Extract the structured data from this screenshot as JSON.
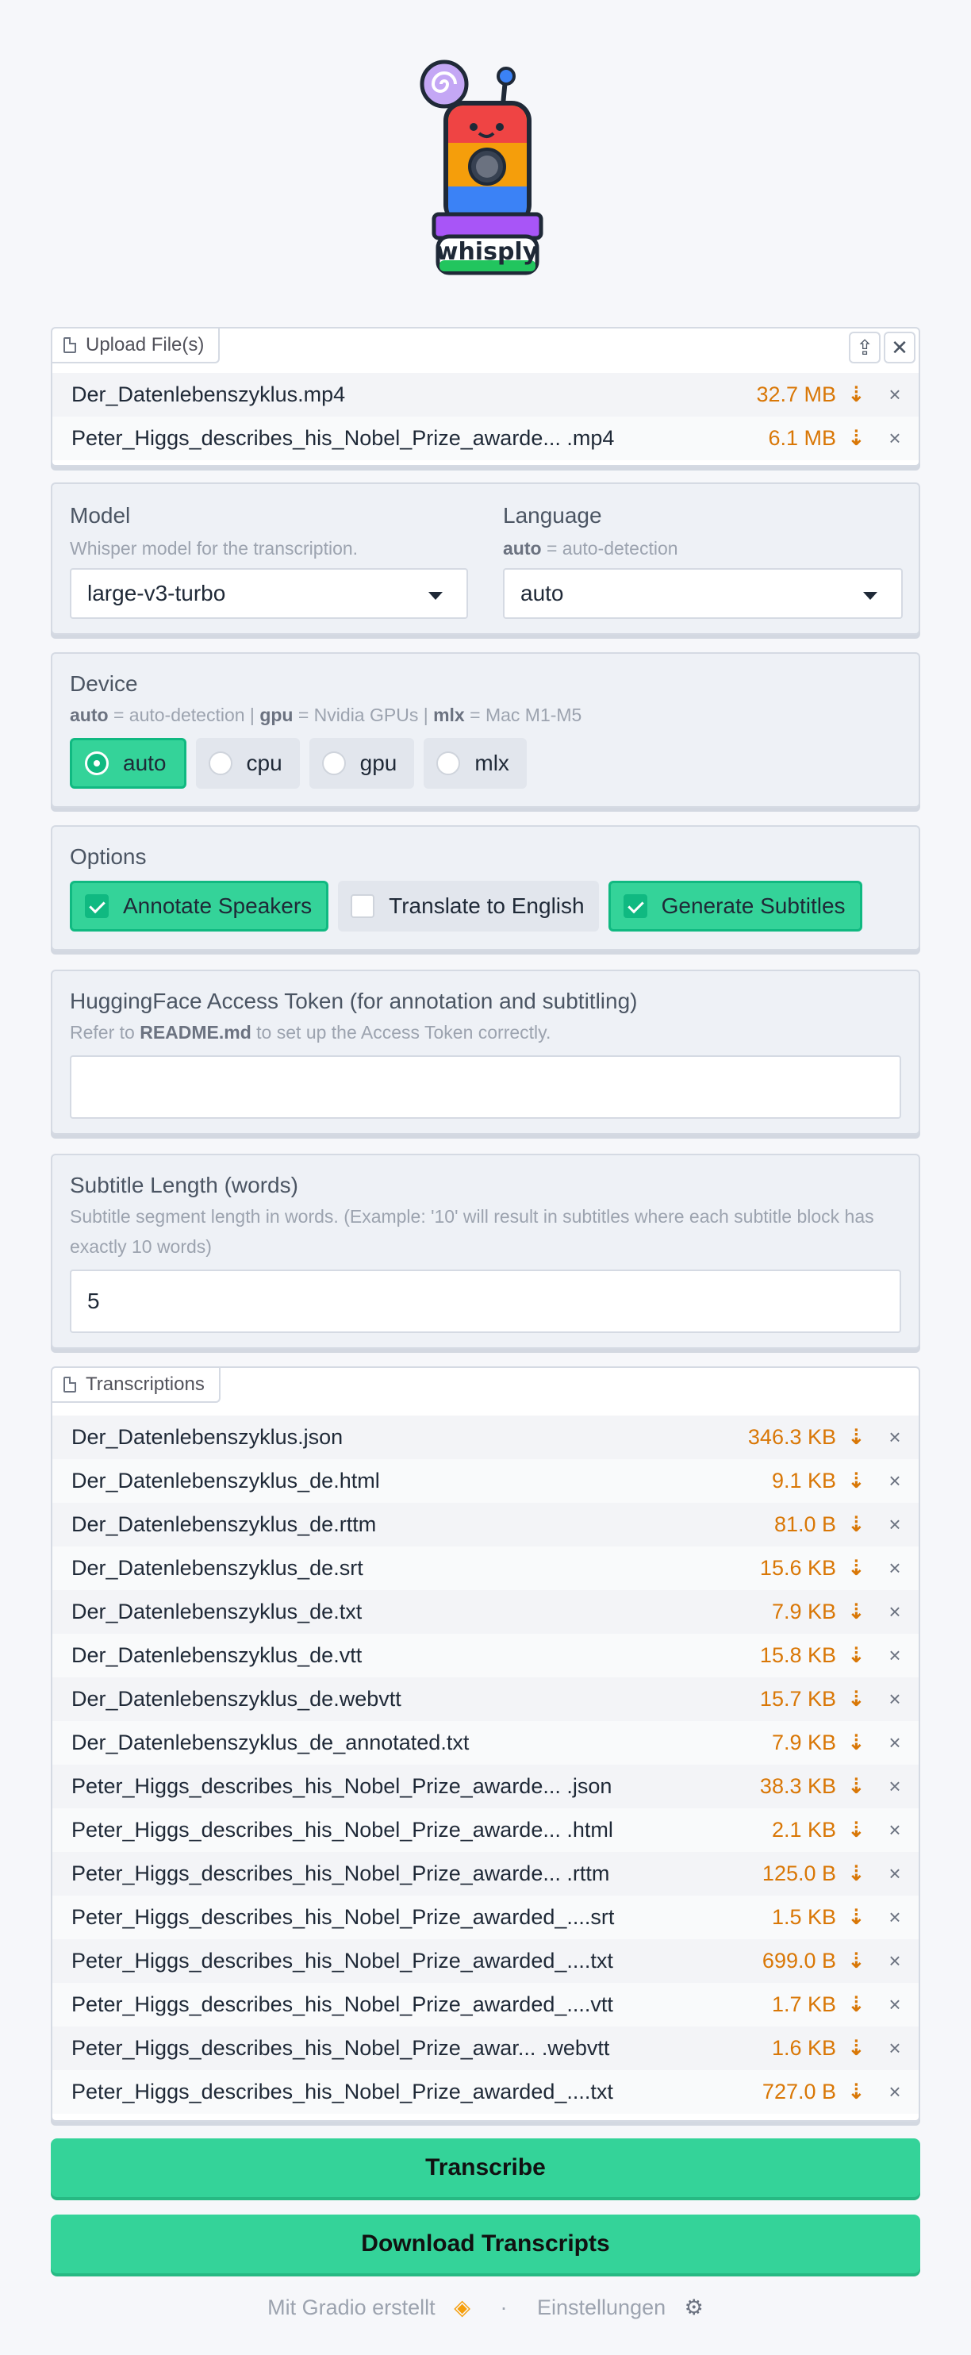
{
  "logo": {
    "text": "whisply"
  },
  "upload": {
    "label": "Upload File(s)",
    "files": [
      {
        "name": "Der_Datenlebenszyklus.mp4",
        "size": "32.7 MB"
      },
      {
        "name": "Peter_Higgs_describes_his_Nobel_Prize_awarde... .mp4",
        "size": "6.1 MB"
      }
    ]
  },
  "model": {
    "title": "Model",
    "info": "Whisper model for the transcription.",
    "value": "large-v3-turbo"
  },
  "language": {
    "title": "Language",
    "info_bold": "auto",
    "info_rest": " = auto-detection",
    "value": "auto"
  },
  "device": {
    "title": "Device",
    "info_parts": [
      {
        "bold": "auto",
        "text": " = auto-detection | "
      },
      {
        "bold": "gpu",
        "text": " = Nvidia GPUs | "
      },
      {
        "bold": "mlx",
        "text": " = Mac M1-M5"
      }
    ],
    "options": [
      "auto",
      "cpu",
      "gpu",
      "mlx"
    ],
    "selected": "auto"
  },
  "options": {
    "title": "Options",
    "items": [
      {
        "label": "Annotate Speakers",
        "checked": true
      },
      {
        "label": "Translate to English",
        "checked": false
      },
      {
        "label": "Generate Subtitles",
        "checked": true
      }
    ]
  },
  "token": {
    "title": "HuggingFace Access Token (for annotation and subtitling)",
    "info_pre": "Refer to ",
    "info_bold": "README.md",
    "info_post": " to set up the Access Token correctly.",
    "value": ""
  },
  "subtitle": {
    "title": "Subtitle Length (words)",
    "info": "Subtitle segment length in words. (Example: '10' will result in subtitles where each subtitle block has exactly 10 words)",
    "value": "5"
  },
  "transcriptions": {
    "label": "Transcriptions",
    "files": [
      {
        "name": "Der_Datenlebenszyklus.json",
        "size": "346.3 KB"
      },
      {
        "name": "Der_Datenlebenszyklus_de.html",
        "size": "9.1 KB"
      },
      {
        "name": "Der_Datenlebenszyklus_de.rttm",
        "size": "81.0 B"
      },
      {
        "name": "Der_Datenlebenszyklus_de.srt",
        "size": "15.6 KB"
      },
      {
        "name": "Der_Datenlebenszyklus_de.txt",
        "size": "7.9 KB"
      },
      {
        "name": "Der_Datenlebenszyklus_de.vtt",
        "size": "15.8 KB"
      },
      {
        "name": "Der_Datenlebenszyklus_de.webvtt",
        "size": "15.7 KB"
      },
      {
        "name": "Der_Datenlebenszyklus_de_annotated.txt",
        "size": "7.9 KB"
      },
      {
        "name": "Peter_Higgs_describes_his_Nobel_Prize_awarde... .json",
        "size": "38.3 KB"
      },
      {
        "name": "Peter_Higgs_describes_his_Nobel_Prize_awarde... .html",
        "size": "2.1 KB"
      },
      {
        "name": "Peter_Higgs_describes_his_Nobel_Prize_awarde... .rttm",
        "size": "125.0 B"
      },
      {
        "name": "Peter_Higgs_describes_his_Nobel_Prize_awarded_....srt",
        "size": "1.5 KB"
      },
      {
        "name": "Peter_Higgs_describes_his_Nobel_Prize_awarded_....txt",
        "size": "699.0 B"
      },
      {
        "name": "Peter_Higgs_describes_his_Nobel_Prize_awarded_....vtt",
        "size": "1.7 KB"
      },
      {
        "name": "Peter_Higgs_describes_his_Nobel_Prize_awar... .webvtt",
        "size": "1.6 KB"
      },
      {
        "name": "Peter_Higgs_describes_his_Nobel_Prize_awarded_....txt",
        "size": "727.0 B"
      }
    ]
  },
  "buttons": {
    "transcribe": "Transcribe",
    "download": "Download Transcripts"
  },
  "footer": {
    "built_with": "Mit Gradio erstellt",
    "separator": "·",
    "settings": "Einstellungen"
  },
  "colors": {
    "accent": "#34d399",
    "accent_border": "#10b981",
    "file_size": "#d97706"
  }
}
